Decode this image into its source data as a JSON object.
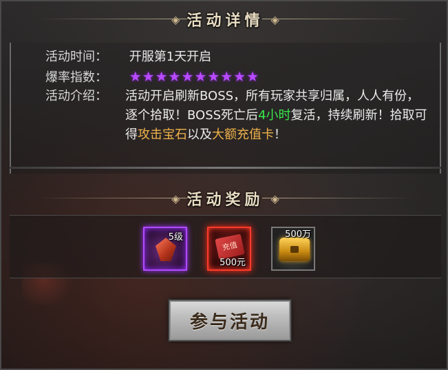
{
  "section1": {
    "title": "活动详情",
    "ornament": "◈"
  },
  "details": {
    "time_label": "活动时间：",
    "time_value": "开服第1天开启",
    "rate_label": "爆率指数：",
    "rate_stars": "★★★★★★★★★★",
    "rate_value": 10,
    "intro_label": "活动介绍：",
    "intro_parts": {
      "p1": "活动开启刷新BOSS，所有玩家共享归属，人人有份，逐个拾取！BOSS死亡后",
      "p2": "4小时",
      "p3": "复活，持续刷新！拾取可得",
      "p4": "攻击宝石",
      "p5": "以及",
      "p6": "大额充值卡",
      "p7": "！"
    }
  },
  "section2": {
    "title": "活动奖励",
    "ornament": "◈"
  },
  "rewards": [
    {
      "name": "attack-gem",
      "badge": "5级",
      "rarity_color": "#b14bff"
    },
    {
      "name": "recharge-card",
      "card_text": "充值",
      "badge": "500元",
      "rarity_color": "#ff3b2a"
    },
    {
      "name": "gold-chest",
      "badge": "500万",
      "rarity_color": "#7a7a7a"
    }
  ],
  "join_button": {
    "label": "参与活动"
  },
  "colors": {
    "green": "#39e84a",
    "gold": "#f0b24b",
    "purple": "#b74bff"
  }
}
